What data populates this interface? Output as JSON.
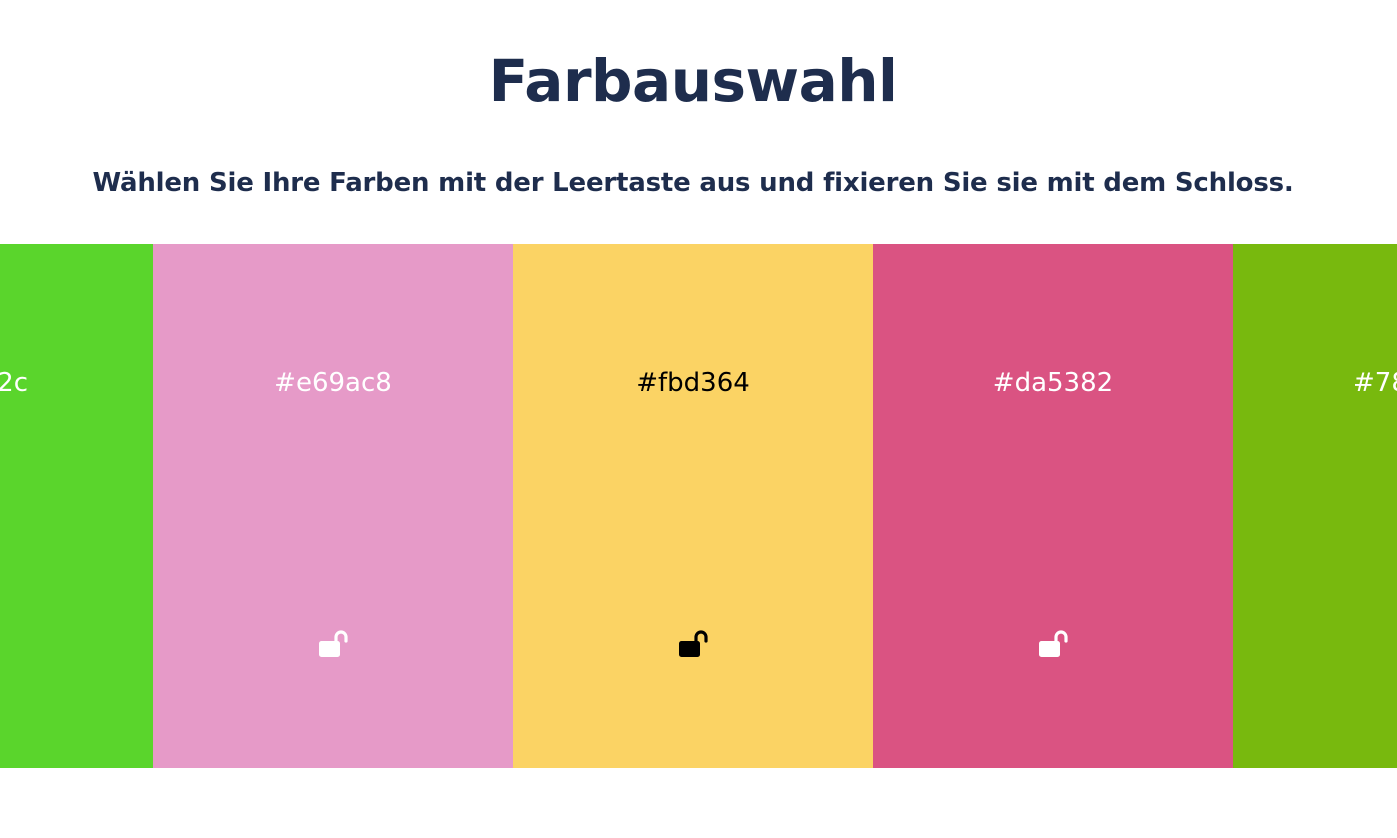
{
  "header": {
    "title": "Farbauswahl",
    "subtitle": "Wählen Sie Ihre Farben mit der Leertaste aus und fixieren Sie sie mit dem Schloss."
  },
  "palette": {
    "swatches": [
      {
        "color": "#5ad52c",
        "label": "2c",
        "text_color": "#ffffff",
        "lock": "unlocked",
        "lock_icon": "unlock-icon"
      },
      {
        "color": "#e69ac8",
        "label": "#e69ac8",
        "text_color": "#ffffff",
        "lock": "unlocked",
        "lock_icon": "unlock-icon"
      },
      {
        "color": "#fbd364",
        "label": "#fbd364",
        "text_color": "#000000",
        "lock": "unlocked",
        "lock_icon": "unlock-icon"
      },
      {
        "color": "#da5382",
        "label": "#da5382",
        "text_color": "#ffffff",
        "lock": "unlocked",
        "lock_icon": "unlock-icon"
      },
      {
        "color": "#78b90e",
        "label": "#78",
        "text_color": "#ffffff",
        "lock": "unlocked",
        "lock_icon": "unlock-icon"
      }
    ]
  }
}
